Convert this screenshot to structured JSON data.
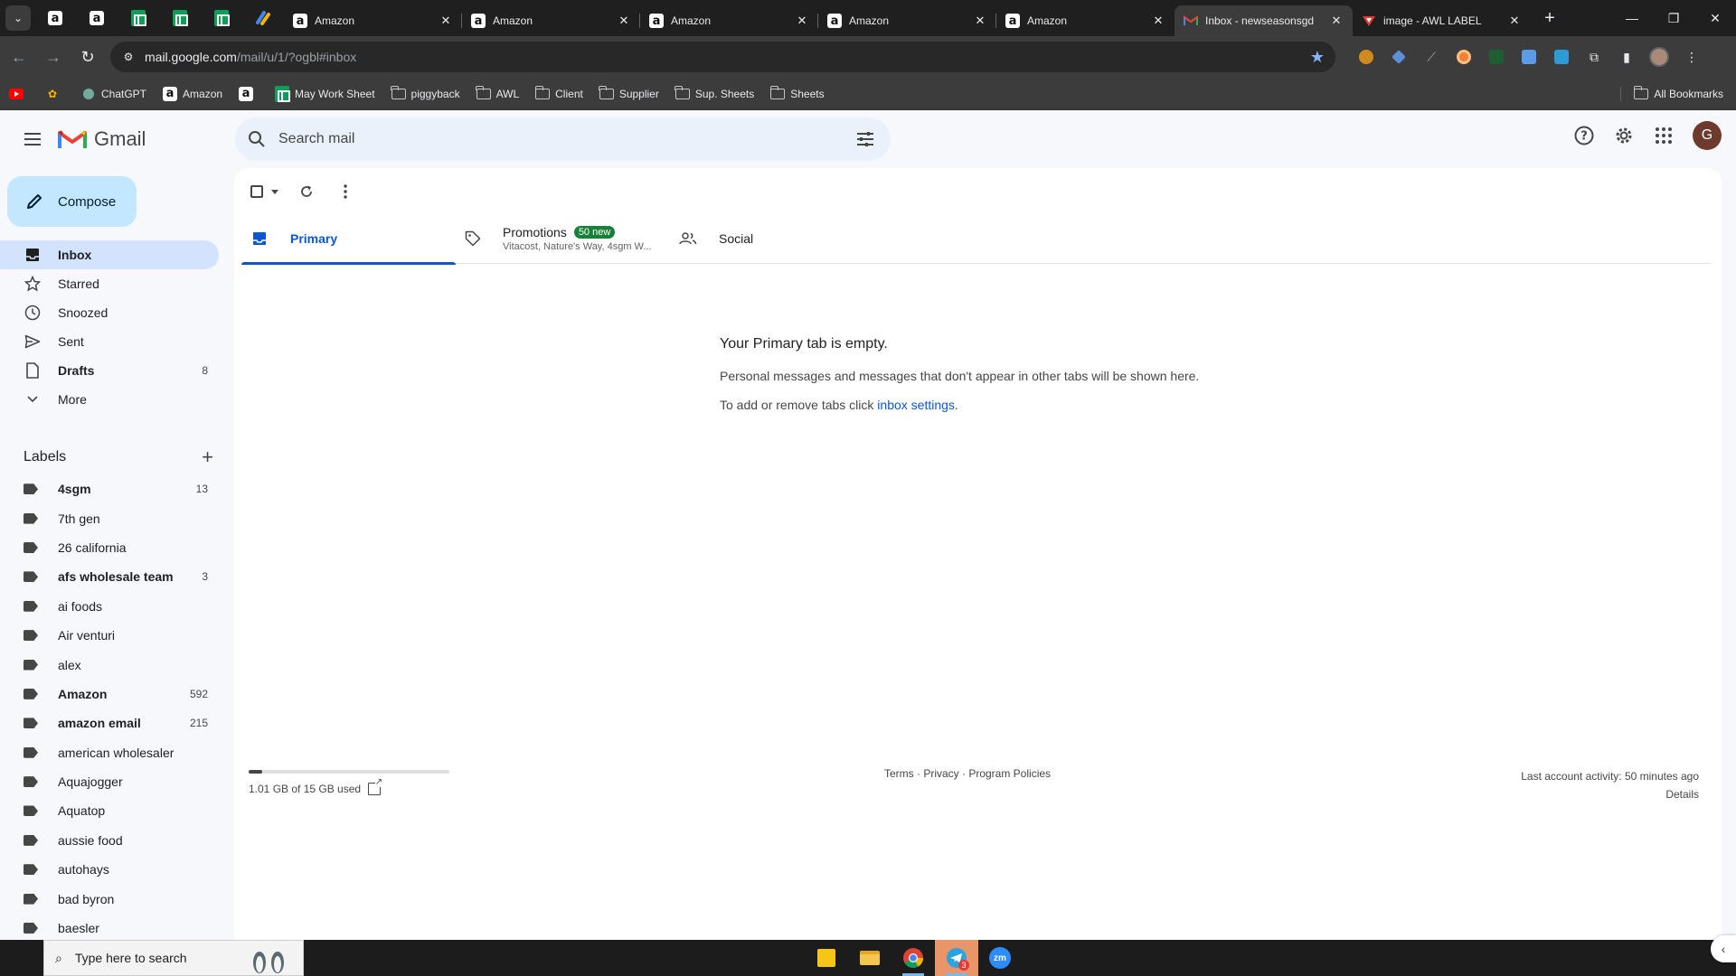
{
  "browser": {
    "tabs": [
      {
        "label": "Amazon",
        "icon": "amazon-icon"
      },
      {
        "label": "Amazon",
        "icon": "amazon-icon"
      },
      {
        "label": "Amazon",
        "icon": "amazon-icon"
      },
      {
        "label": "Amazon",
        "icon": "amazon-icon"
      },
      {
        "label": "Amazon",
        "icon": "amazon-icon"
      },
      {
        "label": "Inbox - newseasonsgd",
        "icon": "gmail-icon",
        "active": true
      },
      {
        "label": "image - AWL LABEL",
        "icon": "awl-icon"
      }
    ],
    "url_host": "mail.google.com",
    "url_path": "/mail/u/1/?ogbl#inbox",
    "bookmarks": [
      {
        "label": "",
        "icon": "youtube-icon"
      },
      {
        "label": "",
        "icon": "extension-icon"
      },
      {
        "label": "ChatGPT",
        "icon": "chatgpt-icon"
      },
      {
        "label": "Amazon",
        "icon": "amazon-icon"
      },
      {
        "label": "",
        "icon": "amazon-icon"
      },
      {
        "label": "May Work Sheet",
        "icon": "sheets-icon"
      },
      {
        "label": "piggyback",
        "icon": "folder-icon"
      },
      {
        "label": "AWL",
        "icon": "folder-icon"
      },
      {
        "label": "Client",
        "icon": "folder-icon"
      },
      {
        "label": "Supplier",
        "icon": "folder-icon"
      },
      {
        "label": "Sup. Sheets",
        "icon": "folder-icon"
      },
      {
        "label": "Sheets",
        "icon": "folder-icon"
      }
    ],
    "all_bookmarks": "All Bookmarks"
  },
  "gmail": {
    "brand": "Gmail",
    "search_placeholder": "Search mail",
    "avatar_letter": "G",
    "compose": "Compose",
    "nav": [
      {
        "label": "Inbox",
        "count": "",
        "icon": "inbox-icon",
        "active": true
      },
      {
        "label": "Starred",
        "count": "",
        "icon": "star-icon"
      },
      {
        "label": "Snoozed",
        "count": "",
        "icon": "clock-icon"
      },
      {
        "label": "Sent",
        "count": "",
        "icon": "send-icon"
      },
      {
        "label": "Drafts",
        "count": "8",
        "icon": "draft-icon",
        "bold": true
      },
      {
        "label": "More",
        "count": "",
        "icon": "chevron-down-icon"
      }
    ],
    "labels_title": "Labels",
    "labels": [
      {
        "label": "4sgm",
        "count": "13",
        "bold": true
      },
      {
        "label": "7th gen",
        "count": ""
      },
      {
        "label": "26 california",
        "count": ""
      },
      {
        "label": "afs wholesale team",
        "count": "3",
        "bold": true
      },
      {
        "label": "ai foods",
        "count": ""
      },
      {
        "label": "Air venturi",
        "count": ""
      },
      {
        "label": "alex",
        "count": ""
      },
      {
        "label": "Amazon",
        "count": "592",
        "bold": true
      },
      {
        "label": "amazon email",
        "count": "215",
        "bold": true
      },
      {
        "label": "american wholesaler",
        "count": ""
      },
      {
        "label": "Aquajogger",
        "count": ""
      },
      {
        "label": "Aquatop",
        "count": ""
      },
      {
        "label": "aussie food",
        "count": ""
      },
      {
        "label": "autohays",
        "count": ""
      },
      {
        "label": "bad byron",
        "count": ""
      },
      {
        "label": "baesler",
        "count": ""
      },
      {
        "label": "",
        "count": ""
      }
    ],
    "tabs": {
      "primary": "Primary",
      "promotions": "Promotions",
      "promotions_badge": "50 new",
      "promotions_snippet": "Vitacost, Nature's Way, 4sgm W...",
      "social": "Social"
    },
    "empty": {
      "title": "Your Primary tab is empty.",
      "desc": "Personal messages and messages that don't appear in other tabs will be shown here.",
      "settings_prefix": "To add or remove tabs click ",
      "settings_link": "inbox settings",
      "settings_suffix": "."
    },
    "footer": {
      "storage": "1.01 GB of 15 GB used",
      "storage_fraction": 0.067,
      "links": "Terms · Privacy · Program Policies",
      "activity": "Last account activity: 50 minutes ago",
      "details": "Details"
    }
  },
  "taskbar": {
    "search_placeholder": "Type here to search",
    "apps": [
      "sticky-notes-icon",
      "file-explorer-icon",
      "chrome-icon",
      "telegram-icon",
      "zoom-icon"
    ],
    "telegram_badge": "3",
    "zoom_label": "zm"
  }
}
